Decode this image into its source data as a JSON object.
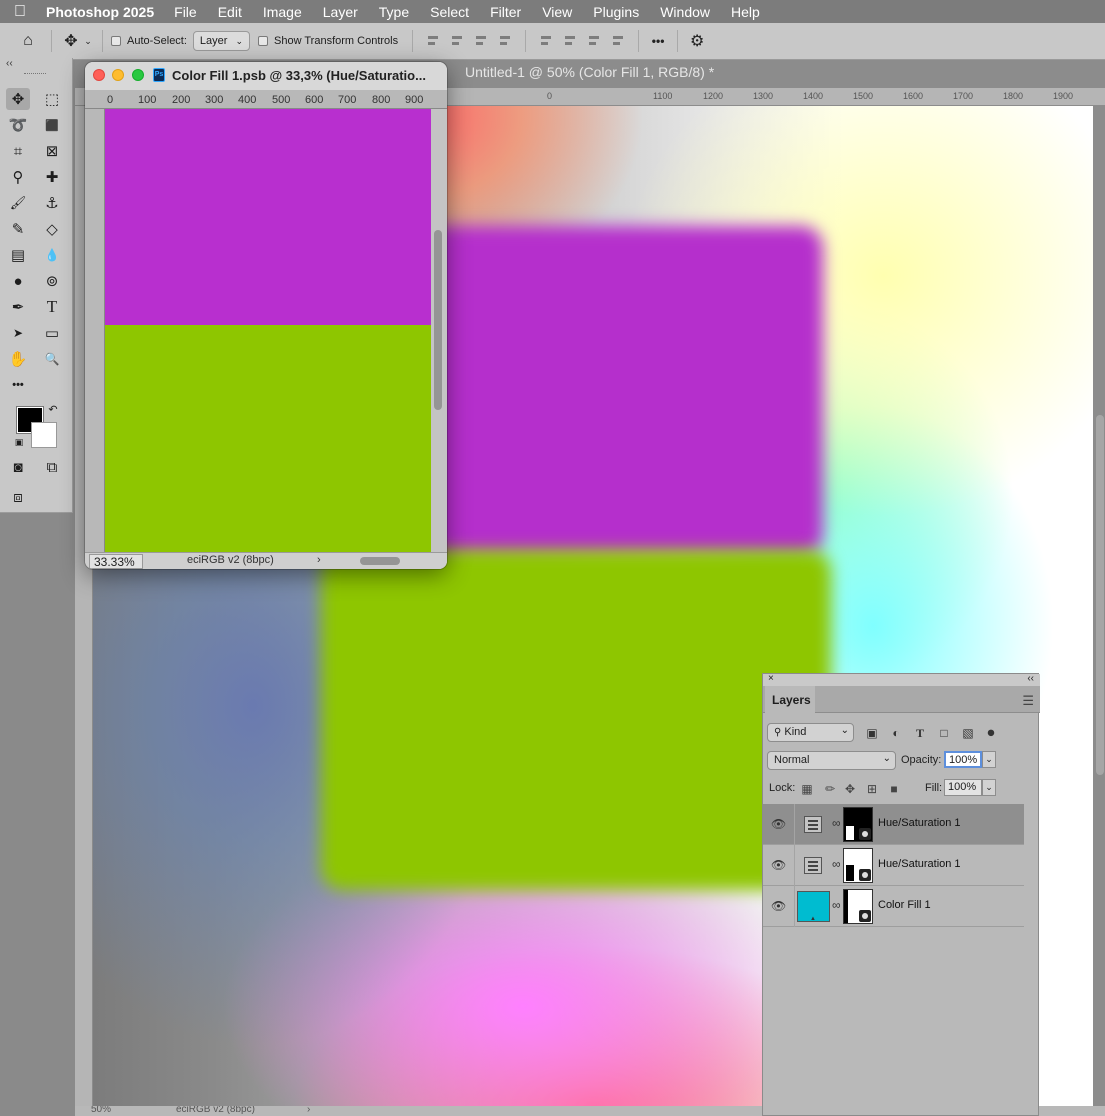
{
  "menubar": {
    "app_name": "Photoshop 2025",
    "items": [
      "File",
      "Edit",
      "Image",
      "Layer",
      "Type",
      "Select",
      "Filter",
      "View",
      "Plugins",
      "Window",
      "Help"
    ]
  },
  "options_bar": {
    "auto_select_label": "Auto-Select:",
    "auto_select_value": "Layer",
    "show_transform_label": "Show Transform Controls",
    "more_icon": "•••"
  },
  "main_document": {
    "title": "Untitled-1 @ 50% (Color Fill 1, RGB/8) *",
    "ruler_ticks": [
      "0",
      "1100",
      "1200",
      "1300",
      "1400",
      "1500",
      "1600",
      "1700",
      "1800",
      "1900"
    ],
    "zoom": "50%",
    "color_profile": "eciRGB v2 (8bpc)",
    "status_arrow": "›"
  },
  "floating_window": {
    "title": "Color Fill 1.psb @ 33,3% (Hue/Saturatio...",
    "file_badge": "Ps",
    "ruler_ticks": [
      "0",
      "100",
      "200",
      "300",
      "400",
      "500",
      "600",
      "700",
      "800",
      "900"
    ],
    "zoom": "33.33%",
    "color_profile": "eciRGB v2 (8bpc)",
    "status_arrow": "›"
  },
  "toolbox": {
    "collapse_label": "‹‹",
    "tools": [
      {
        "name": "move-tool-icon",
        "glyph": "✥"
      },
      {
        "name": "marquee-tool-icon",
        "glyph": "⬚"
      },
      {
        "name": "lasso-tool-icon",
        "glyph": "➰"
      },
      {
        "name": "object-select-tool-icon",
        "glyph": "⬛"
      },
      {
        "name": "crop-tool-icon",
        "glyph": "⌗"
      },
      {
        "name": "frame-tool-icon",
        "glyph": "⊠"
      },
      {
        "name": "eyedropper-tool-icon",
        "glyph": "⚲"
      },
      {
        "name": "healing-brush-tool-icon",
        "glyph": "✚"
      },
      {
        "name": "brush-tool-icon",
        "glyph": "🖌"
      },
      {
        "name": "clone-stamp-tool-icon",
        "glyph": "⚓"
      },
      {
        "name": "history-brush-tool-icon",
        "glyph": "✎"
      },
      {
        "name": "eraser-tool-icon",
        "glyph": "◇"
      },
      {
        "name": "gradient-tool-icon",
        "glyph": "▤"
      },
      {
        "name": "blur-tool-icon",
        "glyph": "💧"
      },
      {
        "name": "dodge-tool-icon",
        "glyph": "●"
      },
      {
        "name": "smudge-tool-icon",
        "glyph": "⊚"
      },
      {
        "name": "pen-tool-icon",
        "glyph": "✒"
      },
      {
        "name": "type-tool-icon",
        "glyph": "T"
      },
      {
        "name": "path-select-tool-icon",
        "glyph": "➤"
      },
      {
        "name": "rectangle-tool-icon",
        "glyph": "▭"
      },
      {
        "name": "hand-tool-icon",
        "glyph": "✋"
      },
      {
        "name": "zoom-tool-icon",
        "glyph": "🔍"
      },
      {
        "name": "edit-toolbar-icon",
        "glyph": "•••"
      },
      {
        "name": "quick-mask-icon",
        "glyph": "◙"
      },
      {
        "name": "screen-mode-icon",
        "glyph": "⧉"
      },
      {
        "name": "generative-fill-icon",
        "glyph": "⧈"
      }
    ]
  },
  "layers_panel": {
    "close_label": "×",
    "collapse_label": "‹‹",
    "tab_label": "Layers",
    "kind_label": "Kind",
    "blend_mode": "Normal",
    "opacity_label": "Opacity:",
    "opacity_value": "100%",
    "lock_label": "Lock:",
    "fill_label": "Fill:",
    "fill_value": "100%",
    "layers": [
      {
        "name": "Hue/Saturation 1",
        "selected": true
      },
      {
        "name": "Hue/Saturation 1",
        "selected": false
      },
      {
        "name": "Color Fill 1",
        "selected": false
      }
    ]
  },
  "colors": {
    "purple_fill": "#b52fcc",
    "green_fill": "#8ec600",
    "color_fill_swatch": "#00bcd0",
    "foreground": "#000000",
    "background": "#ffffff"
  }
}
